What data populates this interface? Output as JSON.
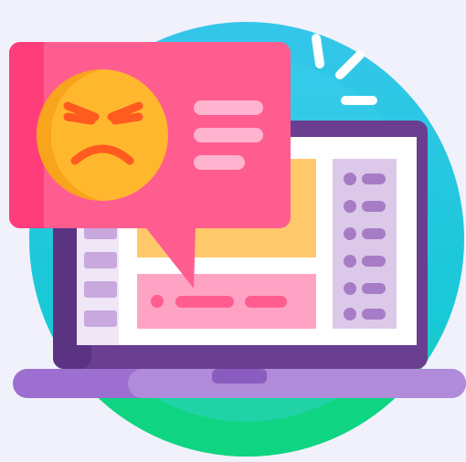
{
  "illustration": {
    "subject": "angry-feedback-on-laptop",
    "icons": [
      "laptop-icon",
      "speech-bubble-icon",
      "angry-face-icon",
      "alert-rays-icon"
    ],
    "colors": {
      "background": "#f1f1fb",
      "circle_top": "#2ec9e6",
      "circle_bottom": "#12d68a",
      "laptop_frame": "#6a3f91",
      "laptop_base": "#9c73c9",
      "screen": "#ffffff",
      "card_yellow": "#ffc96b",
      "card_pink": "#ffa3c4",
      "sidebar_right": "#d9c4e6",
      "sidebar_dot": "#a77cc7",
      "bubble": "#ff5d8f",
      "bubble_dark": "#ff3d7a",
      "face": "#ffb82e",
      "face_shade": "#f7a21b",
      "face_features": "#ff5a1f"
    }
  }
}
